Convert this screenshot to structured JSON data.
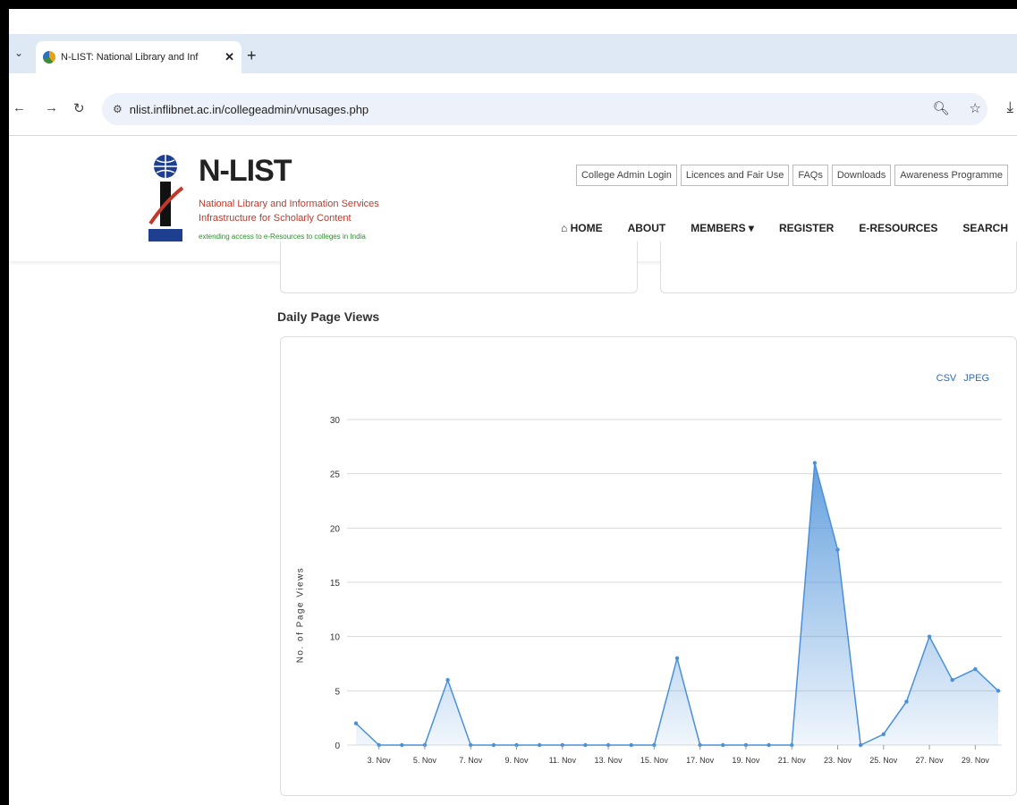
{
  "browser": {
    "tab_title": "N-LIST: National Library and Inf",
    "url": "nlist.inflibnet.ac.in/collegeadmin/vnusages.php"
  },
  "site": {
    "brand": "N-LIST",
    "subtitle_line1": "National Library and Information Services",
    "subtitle_line2": "Infrastructure for Scholarly Content",
    "tagline": "extending access to e-Resources to colleges in India",
    "emblem_text": "INFLIBNET",
    "top_links": [
      "College Admin Login",
      "Licences and Fair Use",
      "FAQs",
      "Downloads",
      "Awareness Programme"
    ],
    "nav": [
      {
        "label": "HOME",
        "icon": "home-icon"
      },
      {
        "label": "ABOUT"
      },
      {
        "label": "MEMBERS ▾"
      },
      {
        "label": "REGISTER"
      },
      {
        "label": "E-RESOURCES"
      },
      {
        "label": "SEARCH"
      }
    ]
  },
  "section": {
    "title": "Daily Page Views",
    "export": [
      "CSV",
      "JPEG"
    ]
  },
  "chart_data": {
    "type": "area",
    "title": "",
    "xlabel": "",
    "ylabel": "No. of Page Views",
    "ylim": [
      0,
      30
    ],
    "yticks": [
      0,
      5,
      10,
      15,
      20,
      25,
      30
    ],
    "x": [
      "2. Nov",
      "3. Nov",
      "4. Nov",
      "5. Nov",
      "6. Nov",
      "7. Nov",
      "8. Nov",
      "9. Nov",
      "10. Nov",
      "11. Nov",
      "12. Nov",
      "13. Nov",
      "14. Nov",
      "15. Nov",
      "16. Nov",
      "17. Nov",
      "18. Nov",
      "19. Nov",
      "20. Nov",
      "21. Nov",
      "22. Nov",
      "23. Nov",
      "24. Nov",
      "25. Nov",
      "26. Nov",
      "27. Nov",
      "28. Nov",
      "29. Nov",
      "30. Nov"
    ],
    "xtick_labels": [
      "3. Nov",
      "5. Nov",
      "7. Nov",
      "9. Nov",
      "11. Nov",
      "13. Nov",
      "15. Nov",
      "17. Nov",
      "19. Nov",
      "21. Nov",
      "23. Nov",
      "25. Nov",
      "27. Nov",
      "29. Nov"
    ],
    "values": [
      2,
      0,
      0,
      0,
      6,
      0,
      0,
      0,
      0,
      0,
      0,
      0,
      0,
      0,
      8,
      0,
      0,
      0,
      0,
      0,
      26,
      18,
      0,
      1,
      4,
      10,
      6,
      7,
      5
    ],
    "color": "#4a90d9",
    "grid": true,
    "legend": "none"
  }
}
